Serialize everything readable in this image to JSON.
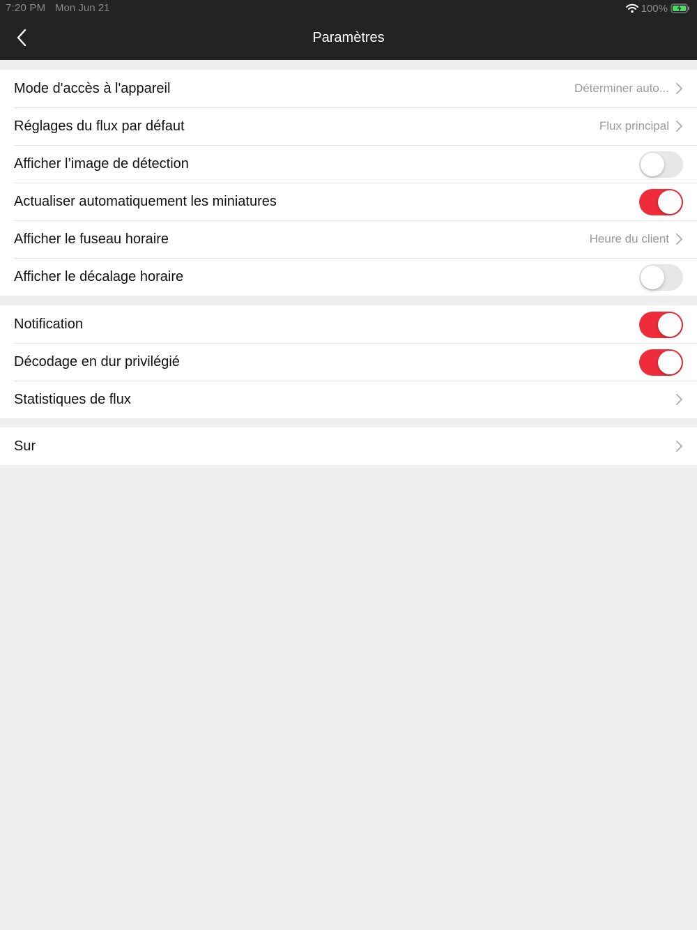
{
  "status_bar": {
    "time": "7:20 PM",
    "date": "Mon Jun 21",
    "battery": "100%"
  },
  "nav": {
    "title": "Paramètres",
    "back_icon": "chevron-left-icon"
  },
  "colors": {
    "toggle_on": "#ee2c3b",
    "toggle_off": "#e7e7e7",
    "nav_background": "#232323",
    "page_background": "#efefef"
  },
  "groups": [
    {
      "rows": [
        {
          "label": "Mode d'accès à l'appareil",
          "value": "Déterminer auto...",
          "chevron": true
        },
        {
          "label": "Réglages du flux par défaut",
          "value": "Flux principal",
          "chevron": true
        },
        {
          "label": "Afficher l’image de détection",
          "toggle": false
        },
        {
          "label": "Actualiser automatiquement les miniatures",
          "toggle": true
        },
        {
          "label": "Afficher le fuseau horaire",
          "value": "Heure du client",
          "chevron": true
        },
        {
          "label": "Afficher le décalage horaire",
          "toggle": false
        }
      ]
    },
    {
      "rows": [
        {
          "label": "Notification",
          "toggle": true
        },
        {
          "label": "Décodage en dur privilégié",
          "toggle": true
        },
        {
          "label": "Statistiques de flux",
          "chevron": true
        }
      ]
    },
    {
      "rows": [
        {
          "label": "Sur",
          "chevron": true
        }
      ]
    }
  ]
}
